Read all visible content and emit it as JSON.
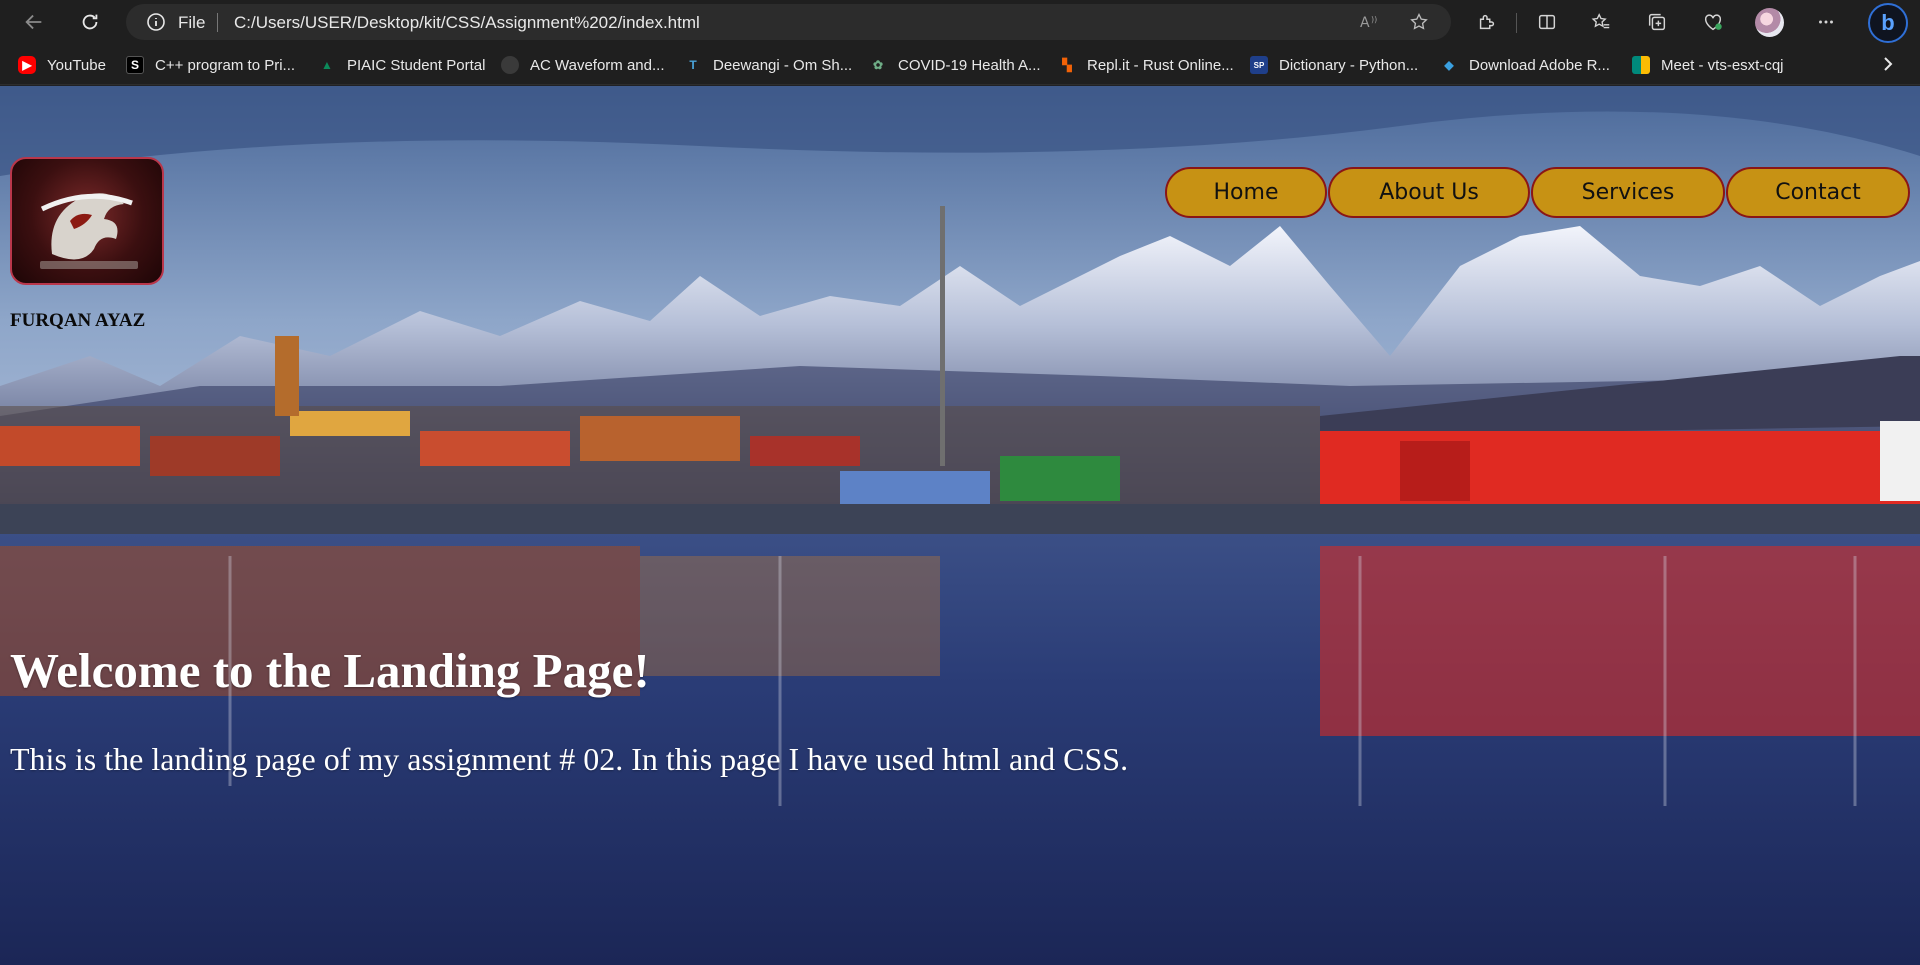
{
  "browser": {
    "address": {
      "scheme_label": "File",
      "url": "C:/Users/USER/Desktop/kit/CSS/Assignment%202/index.html"
    },
    "bookmarks": [
      {
        "label": "YouTube",
        "icon": "youtube-icon",
        "color": "#ff0000"
      },
      {
        "label": "C++ program to Pri...",
        "icon": "studytonight-icon",
        "color": "#000000"
      },
      {
        "label": "PIAIC Student Portal",
        "icon": "piaic-icon",
        "color": "#0c8a5a"
      },
      {
        "label": "AC Waveform and...",
        "icon": "circle-icon",
        "color": "#3a3a3a"
      },
      {
        "label": "Deewangi - Om Sh...",
        "icon": "lyrics-icon",
        "color": "#4aa3d9"
      },
      {
        "label": "COVID-19 Health A...",
        "icon": "health-icon",
        "color": "#3f7f5a"
      },
      {
        "label": "Repl.it - Rust Online...",
        "icon": "replit-icon",
        "color": "#f26207"
      },
      {
        "label": "Dictionary - Python...",
        "icon": "python-site-icon",
        "color": "#1f3f8a"
      },
      {
        "label": "Download Adobe R...",
        "icon": "download-icon",
        "color": "#3aa0e0"
      },
      {
        "label": "Meet - vts-esxt-cqj",
        "icon": "google-meet-icon",
        "color": "#00897b"
      }
    ]
  },
  "site": {
    "logo_name": "FURQAN AYAZ",
    "nav": [
      "Home",
      "About Us",
      "Services",
      "Contact"
    ],
    "heading": "Welcome to the Landing Page!",
    "description": "This is the landing page of my assignment # 02. In this page I have used html and CSS."
  },
  "colors": {
    "nav_fill": "#c79214",
    "nav_border": "#8a1616",
    "browser_bg": "#1f1f1f"
  }
}
